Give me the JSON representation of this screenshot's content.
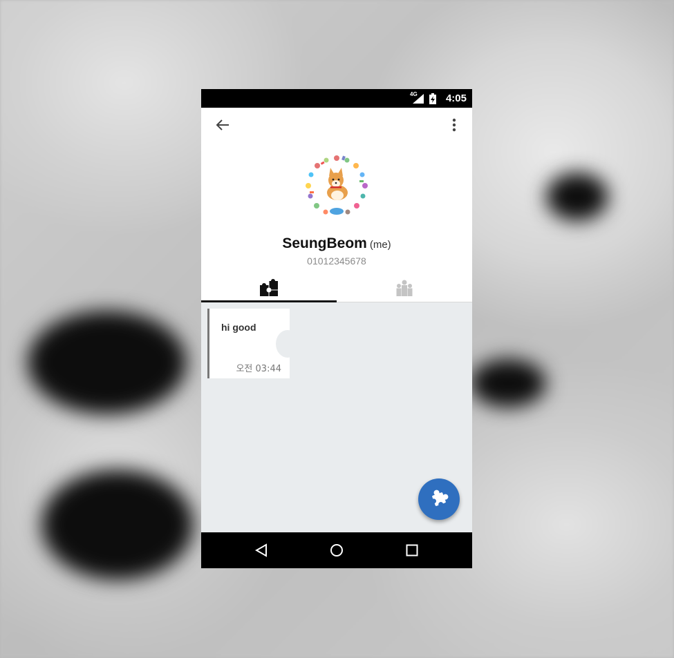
{
  "status_bar": {
    "network": "4G",
    "time": "4:05"
  },
  "app_bar": {
    "back_icon": "arrow-back-icon",
    "menu_icon": "more-vert-icon"
  },
  "profile": {
    "avatar": "corgi-wreath-avatar",
    "name": "SeungBeom",
    "me_label": "(me)",
    "phone": "01012345678"
  },
  "tabs": [
    {
      "icon": "puzzle-pieces-icon",
      "selected": true
    },
    {
      "icon": "group-people-icon",
      "selected": false
    }
  ],
  "messages": [
    {
      "text": "hi good",
      "time": "오전 03:44"
    }
  ],
  "fab": {
    "icon": "puzzle-piece-icon"
  },
  "nav_bar": {
    "back": "nav-back-icon",
    "home": "nav-home-icon",
    "recents": "nav-recents-icon"
  },
  "colors": {
    "accent": "#2f6fbf",
    "content_bg": "#e9ecee",
    "tab_indicator": "#111111"
  }
}
